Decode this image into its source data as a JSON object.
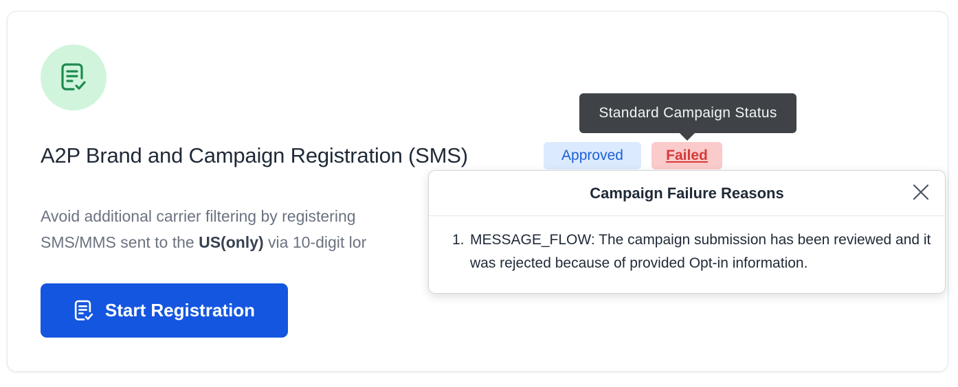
{
  "card": {
    "title": "A2P Brand and Campaign Registration (SMS)",
    "description_line1": "Avoid additional carrier filtering by registering",
    "description_line2_prefix": "SMS/MMS sent to the ",
    "description_line2_bold": "US(only)",
    "description_line2_suffix": " via 10-digit lor",
    "badges": {
      "approved": "Approved",
      "failed": "Failed"
    },
    "start_button_label": "Start Registration",
    "icon": "checklist-document-icon"
  },
  "tooltip": {
    "text": "Standard Campaign Status"
  },
  "popover": {
    "title": "Campaign Failure Reasons",
    "reasons": [
      {
        "number": "1.",
        "text": "MESSAGE_FLOW: The campaign submission has been reviewed and it was rejected because of provided Opt-in information."
      }
    ]
  },
  "colors": {
    "primary": "#1456e0",
    "approved_bg": "#dbeafe",
    "approved_text": "#1d5fd8",
    "failed_bg": "#fbcaca",
    "failed_text": "#d43a3a",
    "icon_bg": "#d1f5dc",
    "icon_stroke": "#1e8a4f"
  }
}
